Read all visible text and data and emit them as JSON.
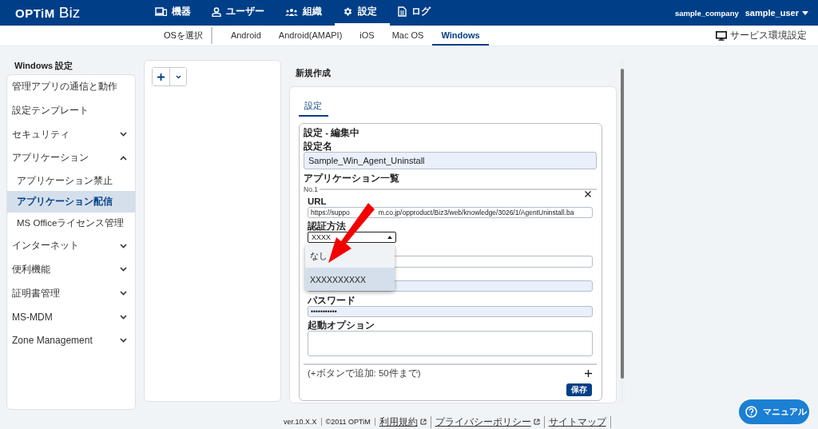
{
  "header": {
    "logo": "OPTiM",
    "logo_suffix": "Biz",
    "nav": [
      {
        "kind": "device",
        "label": "機器",
        "selected": false
      },
      {
        "kind": "user",
        "label": "ユーザー",
        "selected": false
      },
      {
        "kind": "group",
        "label": "組織",
        "selected": false
      },
      {
        "kind": "gear",
        "label": "設定",
        "selected": true
      },
      {
        "kind": "document",
        "label": "ログ",
        "selected": false
      }
    ],
    "company": "sample_company",
    "user": "sample_user"
  },
  "os_nav": {
    "label": "OSを選択",
    "tabs": [
      {
        "label": "Android",
        "selected": false
      },
      {
        "label": "Android(AMAPI)",
        "selected": false
      },
      {
        "label": "iOS",
        "selected": false
      },
      {
        "label": "Mac OS",
        "selected": false
      },
      {
        "label": "Windows",
        "selected": true
      }
    ],
    "service_settings": "サービス環境設定"
  },
  "sidebar": {
    "title": "Windows 設定",
    "items": [
      {
        "kind": "link",
        "label": "管理アプリの通信と動作"
      },
      {
        "kind": "link",
        "label": "設定テンプレート"
      },
      {
        "kind": "group",
        "label": "セキュリティ",
        "expanded": false
      },
      {
        "kind": "group",
        "label": "アプリケーション",
        "expanded": true,
        "children": [
          {
            "label": "アプリケーション禁止",
            "selected": false
          },
          {
            "label": "アプリケーション配信",
            "selected": true
          },
          {
            "label": "MS Officeライセンス管理",
            "selected": false
          }
        ]
      },
      {
        "kind": "group",
        "label": "インターネット",
        "expanded": false
      },
      {
        "kind": "group",
        "label": "便利機能",
        "expanded": false
      },
      {
        "kind": "group",
        "label": "証明書管理",
        "expanded": false
      },
      {
        "kind": "group",
        "label": "MS-MDM",
        "expanded": false
      },
      {
        "kind": "group",
        "label": "Zone Management",
        "expanded": false
      }
    ]
  },
  "editor": {
    "title": "新規作成",
    "tabs": [
      {
        "label": "設定",
        "selected": true
      }
    ],
    "form_title": "設定 - 編集中",
    "name_label": "設定名",
    "name_value": "Sample_Win_Agent_Uninstall",
    "list_label": "アプリケーション一覧",
    "entry": {
      "number": "No.1",
      "url_label": "URL",
      "url_value_parts": [
        "https://suppo",
        "m.co.jp/opproduct/Biz3/web/knowledge/3026/1/AgentUninstall.ba"
      ],
      "auth_label": "認証方法",
      "auth_value": "XXXX",
      "auth_options": [
        {
          "label": "なし",
          "selected": false
        },
        {
          "label": "XXXXXXXXXX",
          "selected": true
        }
      ],
      "hidden_fields": [
        {
          "filled": false
        },
        {
          "filled": true
        }
      ],
      "password_label": "パスワード",
      "password_value": "•••••••••••",
      "options_label": "起動オプション"
    },
    "add_hint": "(+ボタンで追加: 50件まで)",
    "save": "保存"
  },
  "footer": {
    "version": "ver.10.X.X",
    "copyright": "©2011 OPTiM",
    "links": [
      {
        "label": "利用規約",
        "external": true
      },
      {
        "label": "プライバシーポリシー",
        "external": true
      },
      {
        "label": "サイトマップ",
        "external": false
      }
    ]
  },
  "manual": "マニュアル",
  "annotation": {
    "kind": "arrow"
  }
}
